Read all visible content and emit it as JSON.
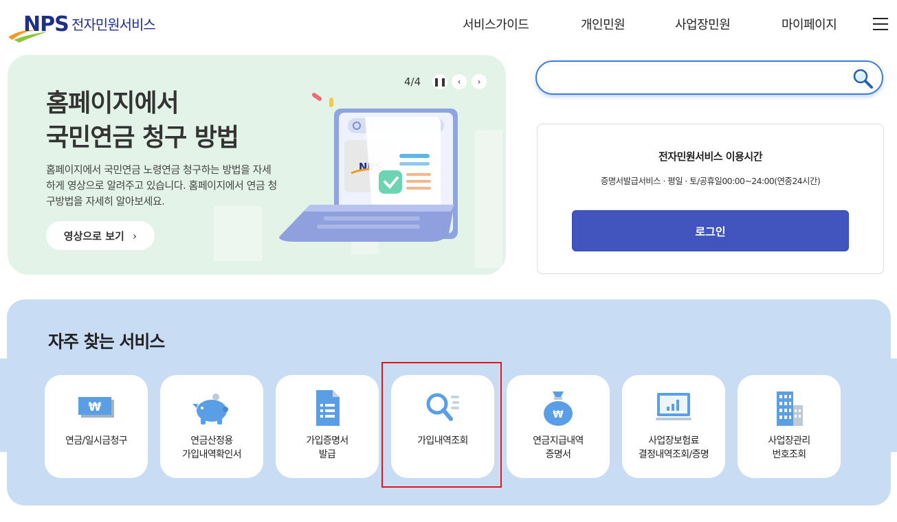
{
  "header": {
    "logo_text": "NPS",
    "site_title": "전자민원서비스",
    "nav": [
      "서비스가이드",
      "개인민원",
      "사업장민원",
      "마이페이지"
    ],
    "menu_icon": "hamburger-menu-icon"
  },
  "banner": {
    "title_line1": "홈페이지에서",
    "title_line2": "국민연금 청구 방법",
    "description": "홈페이지에서 국민연금 노령연금 청구하는 방법을 자세하게 영상으로 알려주고 있습니다. 홈페이지에서 연금 청구방법을 자세히 알아보세요.",
    "button_label": "영상으로 보기",
    "counter": "4/4",
    "illustration_logo": "NPS"
  },
  "search": {
    "placeholder": "",
    "value": ""
  },
  "info_box": {
    "title": "전자민원서비스 이용시간",
    "subtitle": "증명서발급서비스 · 평일 · 토/공휴일00:00~24:00(연중24시간)",
    "login_label": "로그인"
  },
  "services": {
    "title": "자주 찾는 서비스",
    "items": [
      {
        "line1": "연금/일시금청구",
        "line2": "",
        "icon": "won-bill-icon"
      },
      {
        "line1": "연금산정용",
        "line2": "가입내역확인서",
        "icon": "piggy-bank-icon"
      },
      {
        "line1": "가입증명서",
        "line2": "발급",
        "icon": "document-icon"
      },
      {
        "line1": "가입내역조회",
        "line2": "",
        "icon": "search-list-icon"
      },
      {
        "line1": "연금지급내역",
        "line2": "증명서",
        "icon": "money-bag-icon"
      },
      {
        "line1": "사업장보험료",
        "line2": "결정내역조회/증명",
        "icon": "monitor-chart-icon"
      },
      {
        "line1": "사업장관리",
        "line2": "번호조회",
        "icon": "building-icon"
      }
    ]
  },
  "colors": {
    "brand_navy": "#1d2f8c",
    "login_blue": "#4255bf",
    "service_bg": "#c8ddf4",
    "banner_bg": "#e3f3e8",
    "icon_blue": "#4a90e2",
    "highlight_red": "#e0161b"
  }
}
